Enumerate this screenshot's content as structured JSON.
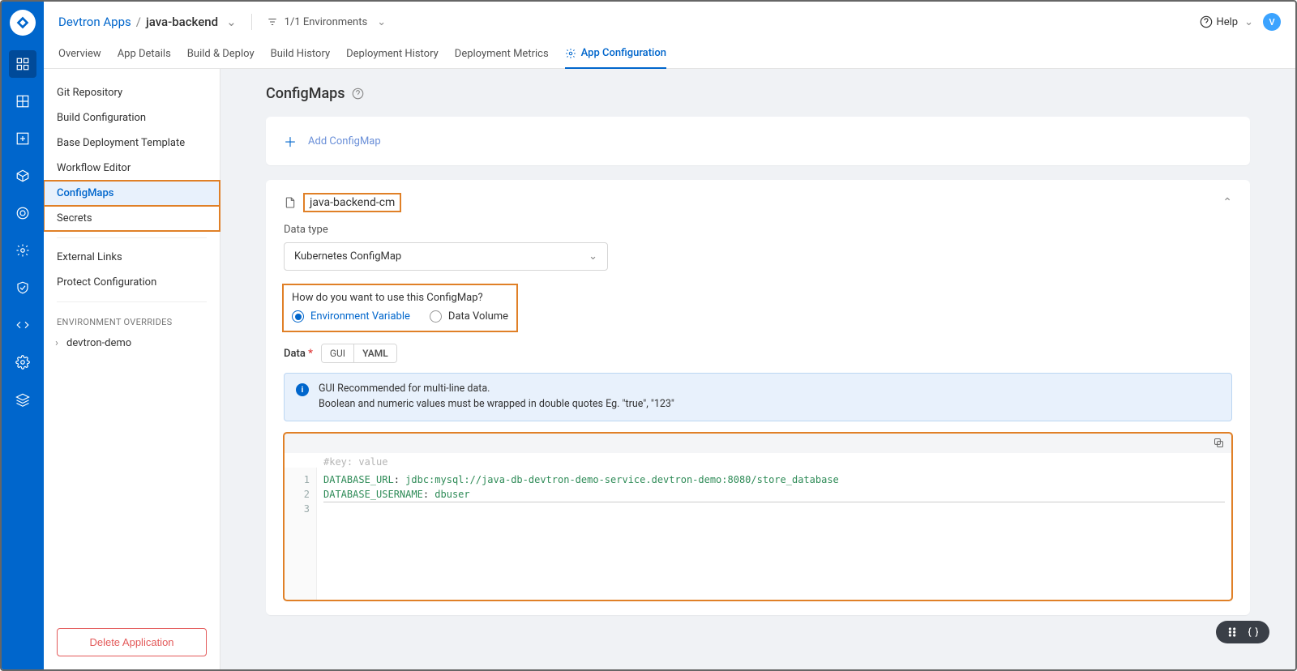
{
  "breadcrumb": {
    "root": "Devtron Apps",
    "sep": "/",
    "current": "java-backend"
  },
  "env_selector": "1/1 Environments",
  "help_label": "Help",
  "avatar_initial": "V",
  "tabs": [
    "Overview",
    "App Details",
    "Build & Deploy",
    "Build History",
    "Deployment History",
    "Deployment Metrics",
    "App Configuration"
  ],
  "sidebar": {
    "items": [
      "Git Repository",
      "Build Configuration",
      "Base Deployment Template",
      "Workflow Editor",
      "ConfigMaps",
      "Secrets"
    ],
    "external": "External Links",
    "protect": "Protect Configuration",
    "env_head": "ENVIRONMENT OVERRIDES",
    "env_item": "devtron-demo",
    "delete": "Delete Application"
  },
  "page": {
    "title": "ConfigMaps",
    "add_label": "Add ConfigMap",
    "cfg_name": "java-backend-cm",
    "data_type_label": "Data type",
    "data_type_value": "Kubernetes ConfigMap",
    "use_label": "How do you want to use this ConfigMap?",
    "radio_env": "Environment Variable",
    "radio_vol": "Data Volume",
    "data_label": "Data",
    "seg_gui": "GUI",
    "seg_yaml": "YAML",
    "banner_l1": "GUI Recommended for multi-line data.",
    "banner_l2": "Boolean and numeric values must be wrapped in double quotes Eg. \"true\", \"123\"",
    "editor": {
      "placeholder": "#key: value",
      "lines": [
        {
          "n": "1",
          "key": "DATABASE_URL",
          "val": "jdbc:mysql://java-db-devtron-demo-service.devtron-demo:8080/store_database"
        },
        {
          "n": "2",
          "key": "DATABASE_USERNAME",
          "val": "dbuser"
        },
        {
          "n": "3",
          "key": "",
          "val": ""
        }
      ]
    }
  }
}
